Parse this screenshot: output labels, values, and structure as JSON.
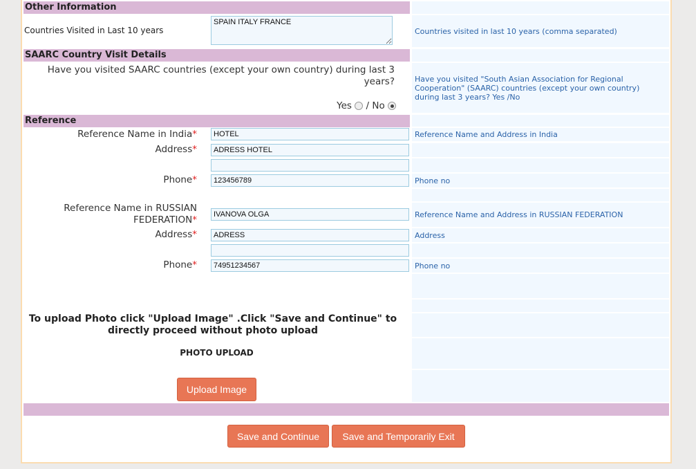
{
  "sections": {
    "other": "Other Information",
    "saarc": "SAARC Country Visit Details",
    "reference": "Reference"
  },
  "countries": {
    "label": "Countries Visited in Last 10 years",
    "value": "SPAIN ITALY FRANCE",
    "help": "Countries visited in last 10 years (comma separated)"
  },
  "saarc": {
    "question": "Have you visited SAARC countries (except your own country) during last 3 years?",
    "yes": "Yes",
    "sep": "/ No",
    "selected": "No",
    "help": "Have you visited \"South Asian Association for Regional Cooperation\" (SAARC) countries (except your own country) during last 3 years? Yes /No"
  },
  "ref_india": {
    "name_label": "Reference Name in India",
    "name_value": "HOTEL",
    "name_help": "Reference Name and Address in India",
    "address_label": "Address",
    "address_value": "ADRESS HOTEL",
    "address2_value": "",
    "phone_label": "Phone",
    "phone_value": "123456789",
    "phone_help": "Phone no"
  },
  "ref_home": {
    "name_label": "Reference Name in RUSSIAN FEDERATION",
    "name_value": "IVANOVA OLGA",
    "name_help": "Reference Name and Address in RUSSIAN FEDERATION",
    "address_label": "Address",
    "address_value": "ADRESS",
    "address_help": "Address",
    "address2_value": "",
    "phone_label": "Phone",
    "phone_value": "74951234567",
    "phone_help": "Phone no"
  },
  "required_mark": "*",
  "upload": {
    "instruction": "To upload Photo click \"Upload Image\" .Click \"Save and Continue\" to directly proceed without photo upload",
    "title": "PHOTO UPLOAD",
    "button": "Upload Image"
  },
  "actions": {
    "save_continue": "Save and Continue",
    "save_exit": "Save and Temporarily Exit"
  }
}
